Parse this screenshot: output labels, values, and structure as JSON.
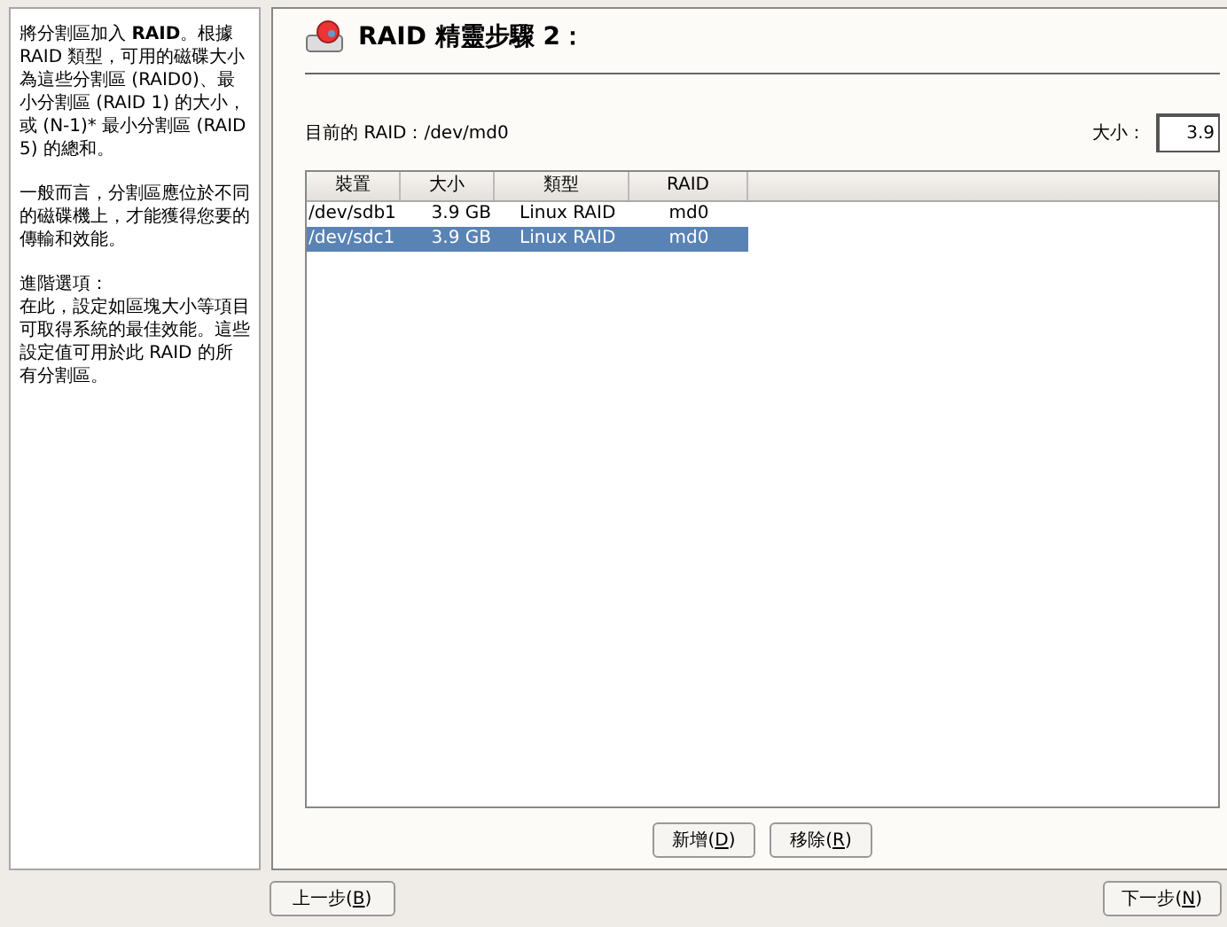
{
  "help": {
    "paragraphs": [
      "將分割區加入 **RAID**。根據 RAID 類型，可用的磁碟大小為這些分割區 (RAID0)、最小分割區 (RAID 1) 的大小，或 (N-1)* 最小分割區 (RAID 5) 的總和。",
      "一般而言，分割區應位於不同的磁碟機上，才能獲得您要的傳輸和效能。",
      "進階選項：",
      "在此，設定如區塊大小等項目可取得系統的最佳效能。這些設定值可用於此 RAID 的所有分割區。"
    ]
  },
  "title": "RAID 精靈步驟 2：",
  "current_raid": "目前的 RAID：/dev/md0",
  "size": {
    "label": "大小：",
    "value": "3.9"
  },
  "table": {
    "columns": [
      "裝置",
      "大小",
      "類型",
      "RAID"
    ],
    "rows": [
      {
        "cells": [
          "/dev/sdb1",
          "3.9 GB",
          "Linux RAID",
          "md0"
        ],
        "selected": false
      },
      {
        "cells": [
          "/dev/sdc1",
          "3.9 GB",
          "Linux RAID",
          "md0"
        ],
        "selected": true
      }
    ]
  },
  "actions": [
    {
      "before": "新增(",
      "mnemonic": "D",
      "after": ")"
    },
    {
      "before": "移除(",
      "mnemonic": "R",
      "after": ")"
    }
  ],
  "back": {
    "before": "上一步(",
    "mnemonic": "B",
    "after": ")"
  },
  "next": {
    "before": "下一步(",
    "mnemonic": "N",
    "after": ")"
  }
}
